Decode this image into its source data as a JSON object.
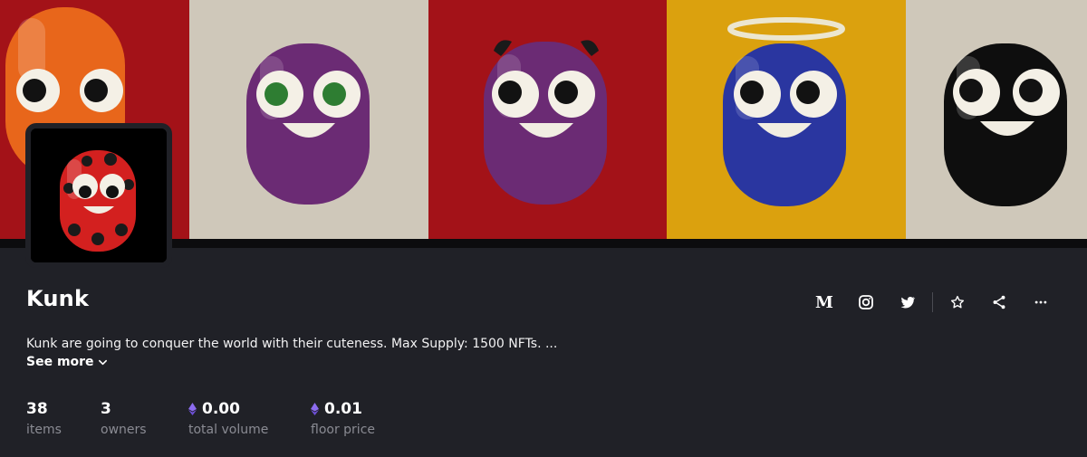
{
  "banner": {
    "panels": [
      {
        "background": "#a31218",
        "body": "#e8661b",
        "eyes": "black"
      },
      {
        "background": "#cfc8ba",
        "body": "#6b2b74",
        "eyes": "green"
      },
      {
        "background": "#a31218",
        "body": "#6b2b74",
        "eyes": "black",
        "extra": "horns"
      },
      {
        "background": "#dba10e",
        "body": "#2a36a0",
        "eyes": "black",
        "extra": "halo"
      },
      {
        "background": "#cfc8ba",
        "body": "#0e0e0e",
        "eyes": "black"
      }
    ]
  },
  "avatar": {
    "background": "#000000",
    "body": "#d3201f",
    "spots": "#1a1a1a"
  },
  "collection": {
    "name": "Kunk",
    "description": "Kunk are going to conquer the world with their cuteness. Max Supply: 1500 NFTs. ...",
    "see_more_label": "See more"
  },
  "stats": [
    {
      "value": "38",
      "label": "items",
      "currency": false
    },
    {
      "value": "3",
      "label": "owners",
      "currency": false
    },
    {
      "value": "0.00",
      "label": "total volume",
      "currency": true
    },
    {
      "value": "0.01",
      "label": "floor price",
      "currency": true
    }
  ],
  "actions": {
    "medium_glyph": "M",
    "items": [
      "medium-icon",
      "instagram-icon",
      "twitter-icon",
      "star-icon",
      "share-icon",
      "more-icon"
    ]
  },
  "colors": {
    "page_bg": "#202127",
    "text": "#ffffff",
    "muted": "#8a8b93",
    "eth": "#8c6cf0"
  }
}
